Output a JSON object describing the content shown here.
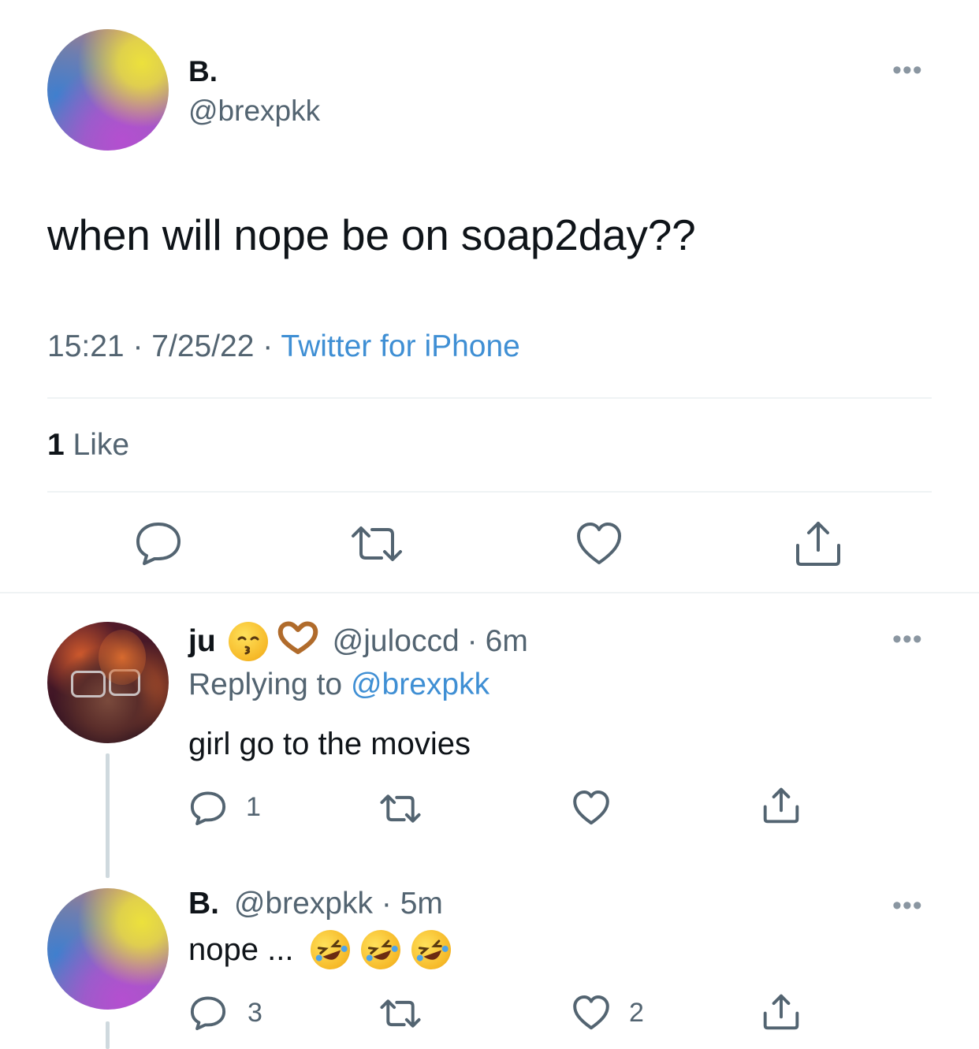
{
  "main_tweet": {
    "display_name": "B.",
    "handle": "@brexpkk",
    "more_icon": "more-horizontal",
    "text": "when will nope be on soap2day??",
    "time": "15:21",
    "sep1": "·",
    "date": "7/25/22",
    "sep2": "·",
    "source": "Twitter for iPhone",
    "likes_count": "1",
    "likes_label": "Like",
    "actions": [
      "reply-icon",
      "retweet-icon",
      "like-icon",
      "share-icon"
    ]
  },
  "reply1": {
    "display_name": "ju",
    "name_emojis": [
      "kissing-face-with-closed-eyes",
      "heart-hands"
    ],
    "handle": "@juloccd",
    "sep": "·",
    "time": "6m",
    "replying_prefix": "Replying to",
    "replying_handle": "@brexpkk",
    "text": "girl go to the movies",
    "reply_count": "1",
    "like_count": ""
  },
  "reply2": {
    "display_name": "B.",
    "handle": "@brexpkk",
    "sep": "·",
    "time": "5m",
    "text": "nope ...",
    "text_emojis": [
      "rolling-on-floor-laughing",
      "rolling-on-floor-laughing",
      "rolling-on-floor-laughing"
    ],
    "reply_count": "3",
    "like_count": "2"
  },
  "colors": {
    "link": "#1d9bf0",
    "muted": "#536471",
    "divider": "#eff3f4"
  }
}
